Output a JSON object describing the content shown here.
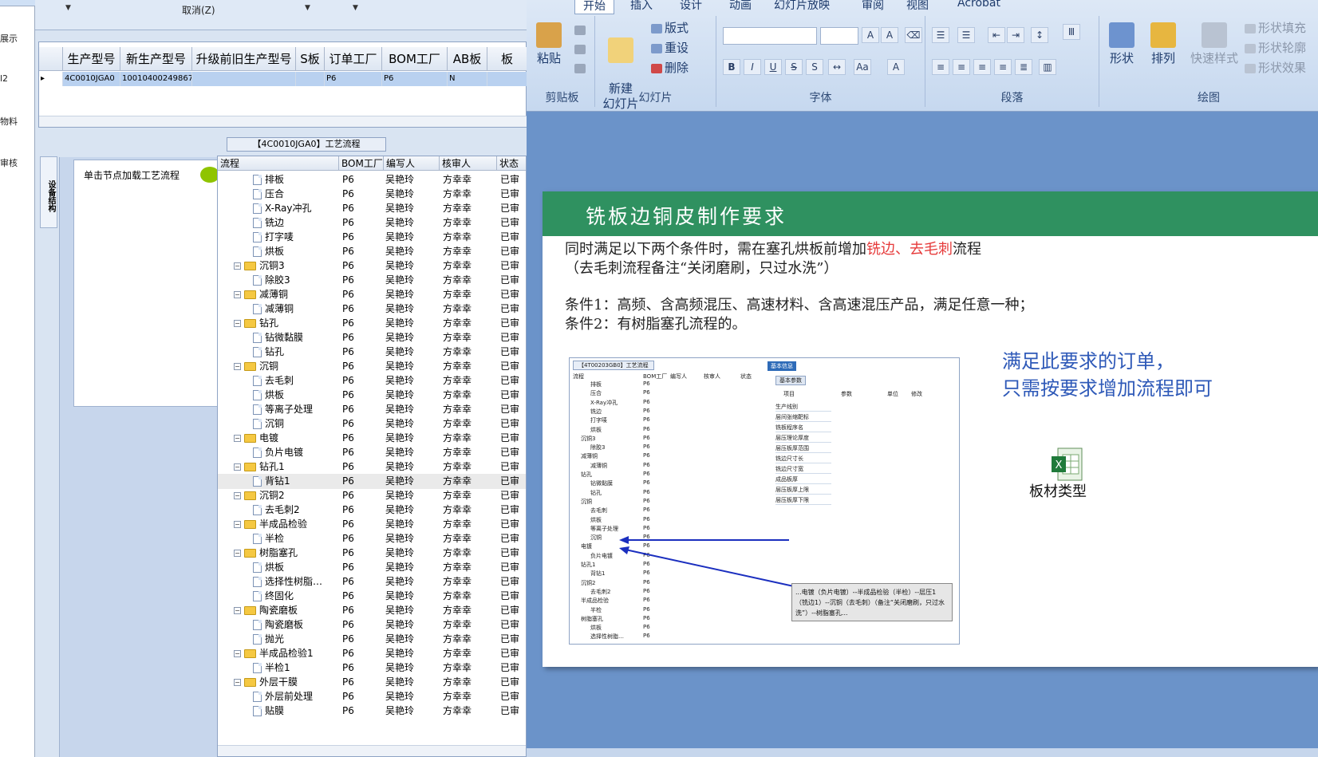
{
  "sidebar": {
    "items": [
      "展示",
      "l2",
      "物料",
      "审核"
    ]
  },
  "toolbar": {
    "cancel_label": "取消(Z)"
  },
  "grid": {
    "columns": [
      "生产型号",
      "新生产型号",
      "升级前旧生产型号",
      "S板",
      "订单工厂",
      "BOM工厂",
      "AB板",
      "板"
    ],
    "row": [
      "4C0010JGA0",
      "10010400249867",
      "",
      "",
      "P6",
      "P6",
      "N",
      ""
    ]
  },
  "flow": {
    "title": "【4C0010JGA0】工艺流程",
    "tab_label": "设备结构",
    "node_hint": "单击节点加载工艺流程",
    "columns": [
      "流程",
      "BOM工厂",
      "编写人",
      "核审人",
      "状态"
    ],
    "rows": [
      {
        "name": "排板",
        "level": 2,
        "folder": false,
        "bom": "P6",
        "author": "吴艳玲",
        "reviewer": "方幸幸",
        "status": "已审"
      },
      {
        "name": "压合",
        "level": 2,
        "folder": false,
        "bom": "P6",
        "author": "吴艳玲",
        "reviewer": "方幸幸",
        "status": "已审"
      },
      {
        "name": "X-Ray冲孔",
        "level": 2,
        "folder": false,
        "bom": "P6",
        "author": "吴艳玲",
        "reviewer": "方幸幸",
        "status": "已审"
      },
      {
        "name": "铣边",
        "level": 2,
        "folder": false,
        "bom": "P6",
        "author": "吴艳玲",
        "reviewer": "方幸幸",
        "status": "已审"
      },
      {
        "name": "打字唛",
        "level": 2,
        "folder": false,
        "bom": "P6",
        "author": "吴艳玲",
        "reviewer": "方幸幸",
        "status": "已审"
      },
      {
        "name": "烘板",
        "level": 2,
        "folder": false,
        "bom": "P6",
        "author": "吴艳玲",
        "reviewer": "方幸幸",
        "status": "已审"
      },
      {
        "name": "沉铜3",
        "level": 1,
        "folder": true,
        "bom": "P6",
        "author": "吴艳玲",
        "reviewer": "方幸幸",
        "status": "已审"
      },
      {
        "name": "除胶3",
        "level": 2,
        "folder": false,
        "bom": "P6",
        "author": "吴艳玲",
        "reviewer": "方幸幸",
        "status": "已审"
      },
      {
        "name": "减薄铜",
        "level": 1,
        "folder": true,
        "bom": "P6",
        "author": "吴艳玲",
        "reviewer": "方幸幸",
        "status": "已审"
      },
      {
        "name": "减薄铜",
        "level": 2,
        "folder": false,
        "bom": "P6",
        "author": "吴艳玲",
        "reviewer": "方幸幸",
        "status": "已审"
      },
      {
        "name": "钻孔",
        "level": 1,
        "folder": true,
        "bom": "P6",
        "author": "吴艳玲",
        "reviewer": "方幸幸",
        "status": "已审"
      },
      {
        "name": "钻微黏膜",
        "level": 2,
        "folder": false,
        "bom": "P6",
        "author": "吴艳玲",
        "reviewer": "方幸幸",
        "status": "已审"
      },
      {
        "name": "钻孔",
        "level": 2,
        "folder": false,
        "bom": "P6",
        "author": "吴艳玲",
        "reviewer": "方幸幸",
        "status": "已审"
      },
      {
        "name": "沉铜",
        "level": 1,
        "folder": true,
        "bom": "P6",
        "author": "吴艳玲",
        "reviewer": "方幸幸",
        "status": "已审"
      },
      {
        "name": "去毛刺",
        "level": 2,
        "folder": false,
        "bom": "P6",
        "author": "吴艳玲",
        "reviewer": "方幸幸",
        "status": "已审"
      },
      {
        "name": "烘板",
        "level": 2,
        "folder": false,
        "bom": "P6",
        "author": "吴艳玲",
        "reviewer": "方幸幸",
        "status": "已审"
      },
      {
        "name": "等离子处理",
        "level": 2,
        "folder": false,
        "bom": "P6",
        "author": "吴艳玲",
        "reviewer": "方幸幸",
        "status": "已审"
      },
      {
        "name": "沉铜",
        "level": 2,
        "folder": false,
        "bom": "P6",
        "author": "吴艳玲",
        "reviewer": "方幸幸",
        "status": "已审"
      },
      {
        "name": "电镀",
        "level": 1,
        "folder": true,
        "bom": "P6",
        "author": "吴艳玲",
        "reviewer": "方幸幸",
        "status": "已审"
      },
      {
        "name": "负片电镀",
        "level": 2,
        "folder": false,
        "bom": "P6",
        "author": "吴艳玲",
        "reviewer": "方幸幸",
        "status": "已审"
      },
      {
        "name": "钻孔1",
        "level": 1,
        "folder": true,
        "bom": "P6",
        "author": "吴艳玲",
        "reviewer": "方幸幸",
        "status": "已审"
      },
      {
        "name": "背钻1",
        "level": 2,
        "folder": false,
        "bom": "P6",
        "author": "吴艳玲",
        "reviewer": "方幸幸",
        "status": "已审",
        "selected": true
      },
      {
        "name": "沉铜2",
        "level": 1,
        "folder": true,
        "bom": "P6",
        "author": "吴艳玲",
        "reviewer": "方幸幸",
        "status": "已审"
      },
      {
        "name": "去毛刺2",
        "level": 2,
        "folder": false,
        "bom": "P6",
        "author": "吴艳玲",
        "reviewer": "方幸幸",
        "status": "已审"
      },
      {
        "name": "半成品检验",
        "level": 1,
        "folder": true,
        "bom": "P6",
        "author": "吴艳玲",
        "reviewer": "方幸幸",
        "status": "已审"
      },
      {
        "name": "半检",
        "level": 2,
        "folder": false,
        "bom": "P6",
        "author": "吴艳玲",
        "reviewer": "方幸幸",
        "status": "已审"
      },
      {
        "name": "树脂塞孔",
        "level": 1,
        "folder": true,
        "bom": "P6",
        "author": "吴艳玲",
        "reviewer": "方幸幸",
        "status": "已审"
      },
      {
        "name": "烘板",
        "level": 2,
        "folder": false,
        "bom": "P6",
        "author": "吴艳玲",
        "reviewer": "方幸幸",
        "status": "已审"
      },
      {
        "name": "选择性树脂…",
        "level": 2,
        "folder": false,
        "bom": "P6",
        "author": "吴艳玲",
        "reviewer": "方幸幸",
        "status": "已审"
      },
      {
        "name": "终固化",
        "level": 2,
        "folder": false,
        "bom": "P6",
        "author": "吴艳玲",
        "reviewer": "方幸幸",
        "status": "已审"
      },
      {
        "name": "陶瓷磨板",
        "level": 1,
        "folder": true,
        "bom": "P6",
        "author": "吴艳玲",
        "reviewer": "方幸幸",
        "status": "已审"
      },
      {
        "name": "陶瓷磨板",
        "level": 2,
        "folder": false,
        "bom": "P6",
        "author": "吴艳玲",
        "reviewer": "方幸幸",
        "status": "已审"
      },
      {
        "name": "抛光",
        "level": 2,
        "folder": false,
        "bom": "P6",
        "author": "吴艳玲",
        "reviewer": "方幸幸",
        "status": "已审"
      },
      {
        "name": "半成品检验1",
        "level": 1,
        "folder": true,
        "bom": "P6",
        "author": "吴艳玲",
        "reviewer": "方幸幸",
        "status": "已审"
      },
      {
        "name": "半检1",
        "level": 2,
        "folder": false,
        "bom": "P6",
        "author": "吴艳玲",
        "reviewer": "方幸幸",
        "status": "已审"
      },
      {
        "name": "外层干膜",
        "level": 1,
        "folder": true,
        "bom": "P6",
        "author": "吴艳玲",
        "reviewer": "方幸幸",
        "status": "已审"
      },
      {
        "name": "外层前处理",
        "level": 2,
        "folder": false,
        "bom": "P6",
        "author": "吴艳玲",
        "reviewer": "方幸幸",
        "status": "已审"
      },
      {
        "name": "贴膜",
        "level": 2,
        "folder": false,
        "bom": "P6",
        "author": "吴艳玲",
        "reviewer": "方幸幸",
        "status": "已审"
      }
    ]
  },
  "ppt": {
    "tabs": [
      "开始",
      "插入",
      "设计",
      "动画",
      "幻灯片放映",
      "审阅",
      "视图",
      "Acrobat"
    ],
    "groups": {
      "clipboard": {
        "label": "剪贴板",
        "paste": "粘贴"
      },
      "slides": {
        "label": "幻灯片",
        "new_slide": "新建\n幻灯片",
        "layout": "版式",
        "reset": "重设",
        "delete": "删除"
      },
      "font": {
        "label": "字体"
      },
      "paragraph": {
        "label": "段落"
      },
      "drawing": {
        "label": "绘图",
        "shape": "形状",
        "arrange": "排列",
        "quick_style": "快速样式",
        "fill": "形状填充",
        "outline": "形状轮廓",
        "effect": "形状效果"
      }
    },
    "slide": {
      "title": "铣板边铜皮制作要求",
      "line1_pre": "同时满足以下两个条件时，需在塞孔烘板前增加",
      "line1_red": "铣边、去毛刺",
      "line1_post": "流程",
      "line2": "（去毛刺流程备注“关闭磨刷，只过水洗”）",
      "cond1": "条件1：高频、含高频混压、高速材料、含高速混压产品，满足任意一种；",
      "cond2": "条件2：有树脂塞孔流程的。",
      "note1": "满足此要求的订单，",
      "note2": "只需按要求增加流程即可",
      "excel_label": "板材类型",
      "shot": {
        "title": "【4T00203GB0】工艺流程",
        "panel_tab": "基本信息",
        "panel_sub": "基本参数",
        "cols": [
          "流程",
          "BOM工厂",
          "编写人",
          "核审人",
          "状态"
        ],
        "pcols": [
          "项目",
          "参数",
          "单位",
          "修改"
        ],
        "prows": [
          "生产线别",
          "层间张缩靶标",
          "铣板程序名",
          "层压理论厚度",
          "层压板厚范围",
          "铣边尺寸长",
          "铣边尺寸宽",
          "成品板厚",
          "层压板厚上限",
          "层压板厚下限"
        ],
        "callout": "...电镀（负片电镀）--半成品检验（半检）--层压1（铣边1）--沉铜（去毛刺）（备注“关闭磨刷，只过水洗”）--树脂塞孔..."
      }
    }
  }
}
